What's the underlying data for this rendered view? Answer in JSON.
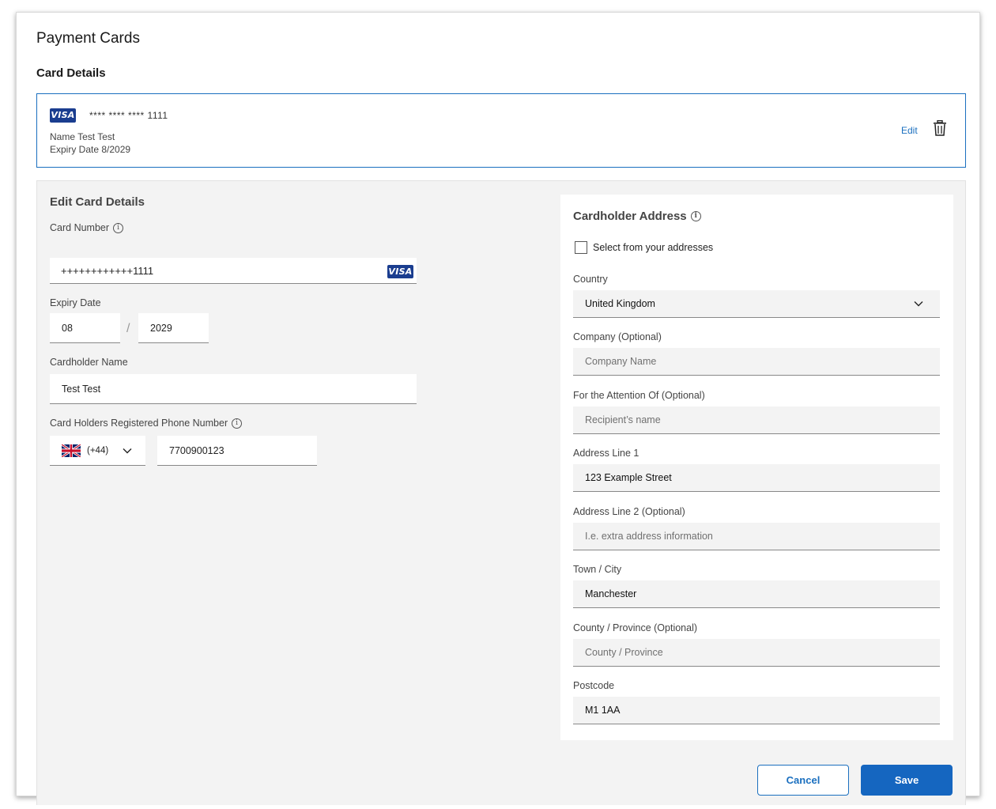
{
  "page": {
    "title": "Payment Cards",
    "section_title": "Card Details"
  },
  "card": {
    "brand": "VISA",
    "masked_number": "**** **** **** 1111",
    "name_line": "Name Test Test",
    "expiry_line": "Expiry Date 8/2029",
    "edit_label": "Edit",
    "delete_icon": "trash-icon"
  },
  "edit_form": {
    "title": "Edit Card Details",
    "card_number_label": "Card Number",
    "card_number_value": "++++++++++++1111",
    "card_brand": "VISA",
    "expiry_label": "Expiry Date",
    "expiry_month": "08",
    "expiry_separator": "/",
    "expiry_year": "2029",
    "cardholder_name_label": "Cardholder Name",
    "cardholder_name_value": "Test Test",
    "phone_label": "Card Holders Registered Phone Number",
    "phone_country_code": "(+44)",
    "phone_country_flag": "uk-flag-icon",
    "phone_number": "7700900123"
  },
  "address": {
    "title": "Cardholder Address",
    "select_addresses_label": "Select from your addresses",
    "select_addresses_checked": false,
    "country_label": "Country",
    "country_value": "United Kingdom",
    "company_label": "Company (Optional)",
    "company_placeholder": "Company Name",
    "attention_label": "For the Attention Of (Optional)",
    "attention_placeholder": "Recipient’s name",
    "line1_label": "Address Line 1",
    "line1_value": "123 Example Street",
    "line2_label": "Address Line 2 (Optional)",
    "line2_placeholder": "I.e. extra address information",
    "town_label": "Town / City",
    "town_value": "Manchester",
    "county_label": "County / Province (Optional)",
    "county_placeholder": "County / Province",
    "postcode_label": "Postcode",
    "postcode_value": "M1 1AA"
  },
  "actions": {
    "cancel_label": "Cancel",
    "save_label": "Save"
  },
  "colors": {
    "accent": "#1566c0",
    "visa": "#1a3d8f",
    "panel_bg": "#f3f3f3"
  }
}
